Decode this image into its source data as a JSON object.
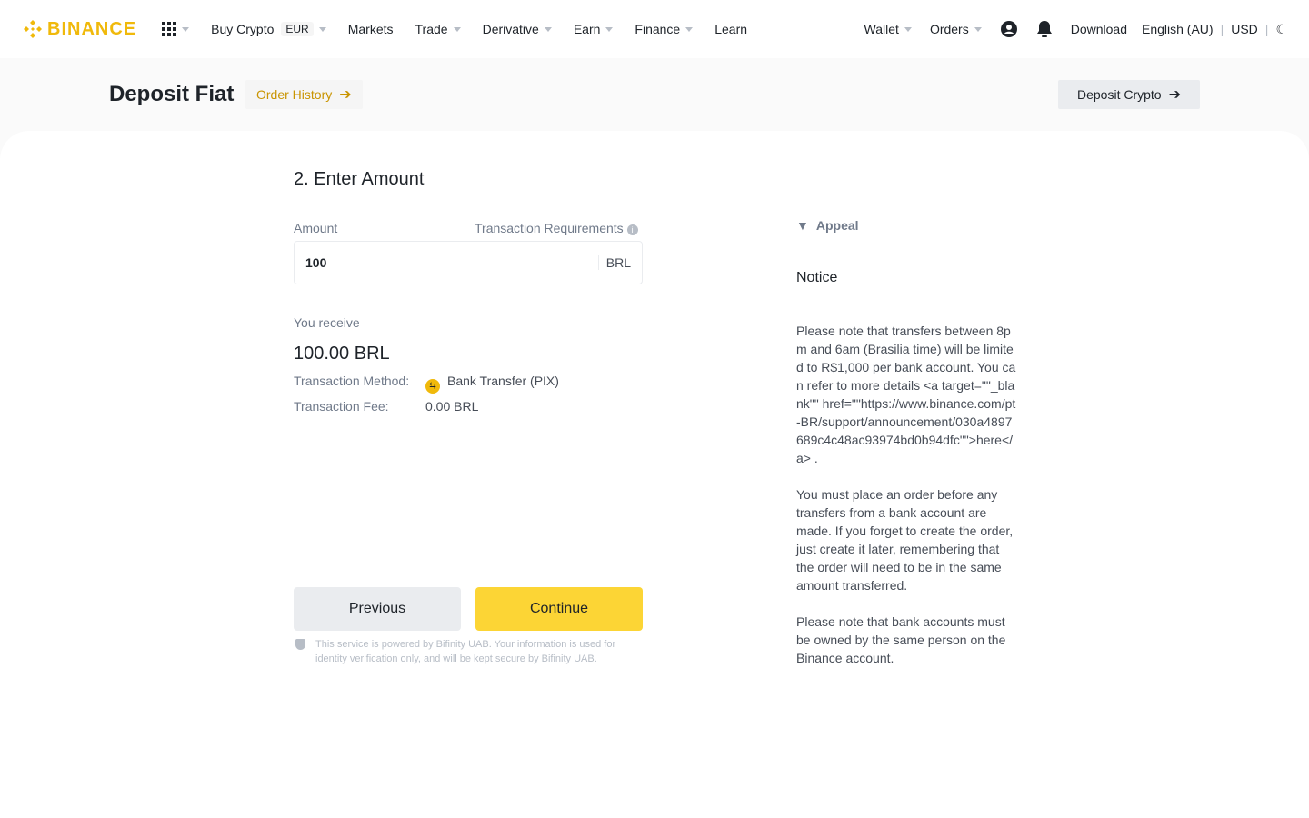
{
  "nav": {
    "brand": "BINANCE",
    "items": [
      "Buy Crypto",
      "Markets",
      "Trade",
      "Derivative",
      "Earn",
      "Finance",
      "Learn"
    ],
    "currency_badge": "EUR",
    "wallet": "Wallet",
    "orders": "Orders",
    "download": "Download",
    "language": "English (AU)",
    "currency": "USD"
  },
  "header": {
    "title": "Deposit Fiat",
    "order_history": "Order History",
    "deposit_crypto": "Deposit Crypto"
  },
  "form": {
    "step_title": "2. Enter Amount",
    "amount_label": "Amount",
    "requirements_label": "Transaction Requirements",
    "amount_value": "100",
    "amount_currency": "BRL",
    "receive_label": "You receive",
    "receive_value": "100.00 BRL",
    "method_label": "Transaction Method:",
    "method_value": "Bank Transfer (PIX)",
    "fee_label": "Transaction Fee:",
    "fee_value": "0.00 BRL",
    "previous": "Previous",
    "continue": "Continue",
    "disclaimer": "This service is powered by Bifinity UAB. Your information is used for identity verification only, and will be kept secure by Bifinity UAB."
  },
  "side": {
    "appeal": "Appeal",
    "notice_title": "Notice",
    "paragraphs": [
      "Please note that transfers between 8pm and 6am (Brasilia time) will be limited to R$1,000 per bank account. You can refer to more details <a target=\"\"_blank\"\" href=\"\"https://www.binance.com/pt-BR/support/announcement/030a4897689c4c48ac93974bd0b94dfc\"\">here</a> .",
      "You must place an order before any transfers from a bank account are made. If you forget to create the order, just create it later, remembering that the order will need to be in the same amount transferred.",
      "Please note that bank accounts must be owned by the same person on the Binance account."
    ]
  },
  "colors": {
    "brand": "#f0b90b",
    "primary_button": "#fcd535"
  }
}
